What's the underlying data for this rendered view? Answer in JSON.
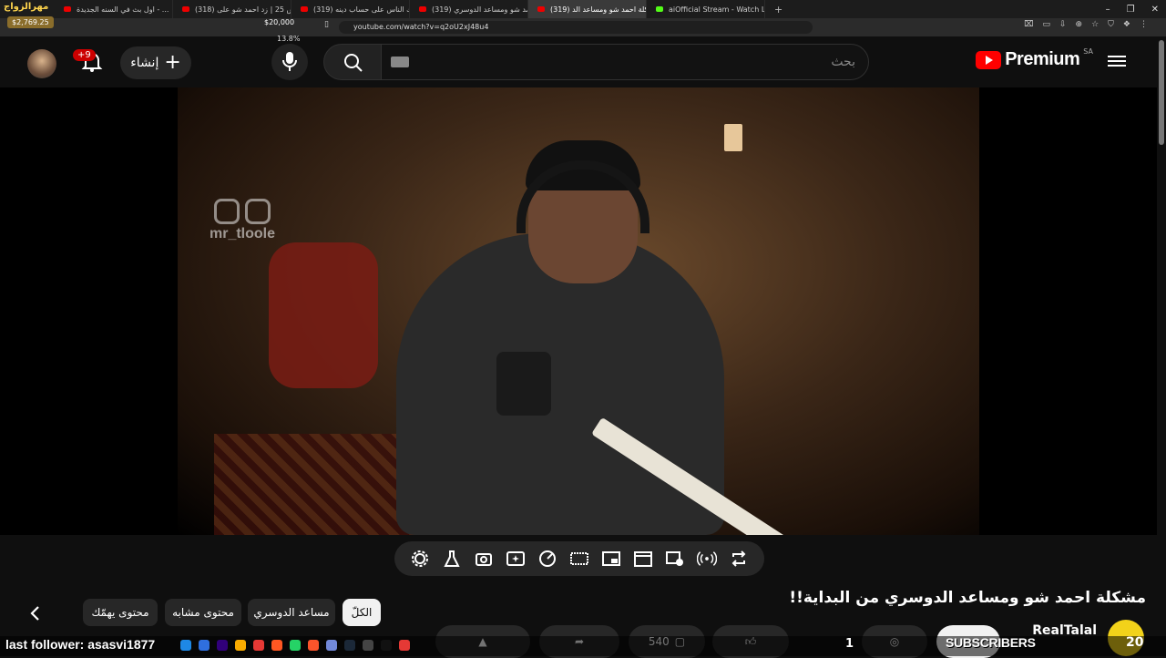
{
  "browser": {
    "tabs": [
      {
        "label": "اول بث في السنه الجديدة - ..."
      },
      {
        "label": "(318) لاعبة اكس 25 | زد احمد شو على ..."
      },
      {
        "label": "(319) يضحك الناس على حساب دينه !!"
      },
      {
        "label": "(319) احمد شو ومساعد الدوسري - ...be"
      },
      {
        "label": "(319) مشكلة احمد شو ومساعد الد..."
      },
      {
        "label": "aiOfficial Stream - Watch Live on Ki..."
      }
    ],
    "url": "youtube.com/watch?v=q2oU2xJ48u4",
    "new_tab": "+"
  },
  "overlay": {
    "top_left_text": "مهرالزواج",
    "price_left": "$2,769.25",
    "price_mid": "$20,000",
    "percent": "13.8%",
    "last_follower": "last follower: asasvi1877",
    "subscribers_label": "SUBSCRIBERS",
    "subscribers_count": "20",
    "count_one": "1"
  },
  "masthead": {
    "logo_text": "Premium",
    "country_code": "SA",
    "search_placeholder": "بحث",
    "create_label": "إنشاء",
    "notif_badge": "+9"
  },
  "video": {
    "watermark": "mr_tloole"
  },
  "title": "مشكلة احمد شو ومساعد الدوسري من البداية!!",
  "chips": [
    {
      "label": "الكلّ",
      "active": true
    },
    {
      "label": "مساعد الدوسري"
    },
    {
      "label": "محتوى مشابه"
    },
    {
      "label": "محتوى يهمّك"
    }
  ],
  "channel": {
    "name": "RealTalal"
  },
  "actions": {
    "views_partial": "540"
  },
  "colors": {
    "background": "#0f0f0f",
    "accent_red": "#ff0000",
    "chip_bg": "#272727"
  }
}
